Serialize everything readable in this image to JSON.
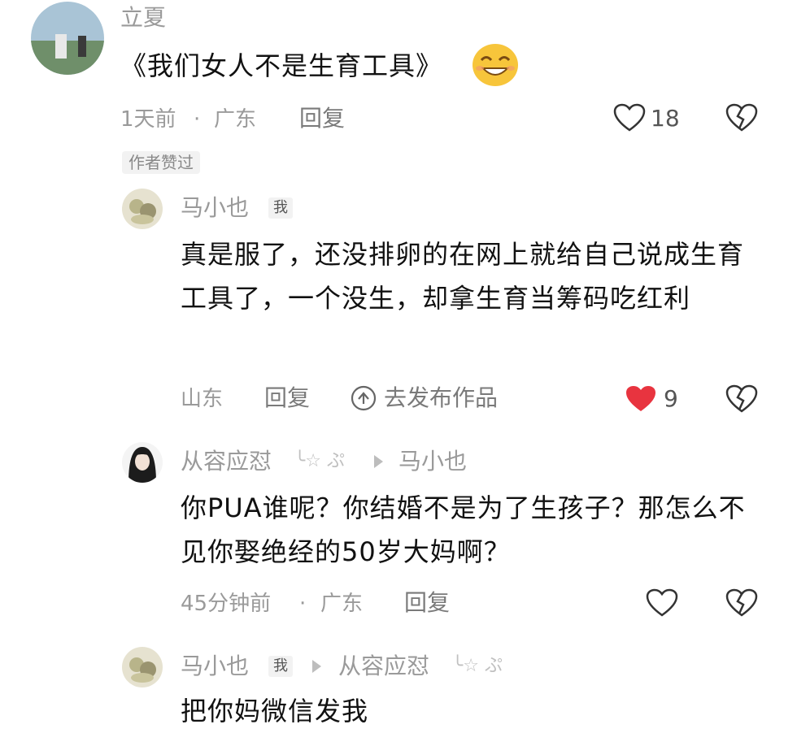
{
  "comment1": {
    "author": "立夏",
    "text": "《我们女人不是生育工具》",
    "time": "1天前",
    "separator": "·",
    "location": "广东",
    "reply_label": "回复",
    "like_count": "18",
    "author_liked_badge": "作者赞过"
  },
  "reply1": {
    "author": "马小也",
    "me_badge": "我",
    "text": "真是服了，还没排卵的在网上就给自己说成生育工具了，一个没生，却拿生育当筹码吃红利",
    "location": "山东",
    "reply_label": "回复",
    "publish_label": "去发布作品",
    "like_count": "9"
  },
  "reply2": {
    "author": "从容应怼",
    "author_deco": "╰☆ ぷ",
    "reply_to": "马小也",
    "text": "你PUA谁呢？你结婚不是为了生孩子？那怎么不见你娶绝经的50岁大妈啊？",
    "time": "45分钟前",
    "separator": "·",
    "location": "广东",
    "reply_label": "回复"
  },
  "reply3": {
    "author": "马小也",
    "me_badge": "我",
    "reply_to": "从容应怼",
    "reply_to_deco": "╰☆ ぷ",
    "text": "把你妈微信发我"
  },
  "colors": {
    "liked_heart": "#e8343f",
    "muted_text": "#9a9a9a",
    "body_text": "#111111"
  }
}
